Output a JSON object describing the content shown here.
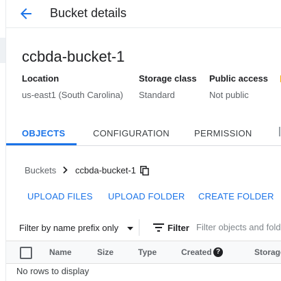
{
  "header": {
    "title": "Bucket details"
  },
  "bucket": {
    "name": "ccbda-bucket-1"
  },
  "info": [
    {
      "label": "Location",
      "value": "us-east1 (South Carolina)"
    },
    {
      "label": "Storage class",
      "value": "Standard"
    },
    {
      "label": "Public access",
      "value": "Not public"
    }
  ],
  "tabs": [
    {
      "label": "OBJECTS",
      "active": true
    },
    {
      "label": "CONFIGURATION",
      "active": false
    },
    {
      "label": "PERMISSION",
      "active": false
    }
  ],
  "breadcrumb": {
    "root": "Buckets",
    "current": "ccbda-bucket-1"
  },
  "actions": {
    "upload_files": "UPLOAD FILES",
    "upload_folder": "UPLOAD FOLDER",
    "create_folder": "CREATE FOLDER"
  },
  "filter": {
    "prefix_label": "Filter by name prefix only",
    "label": "Filter",
    "placeholder": "Filter objects and folders"
  },
  "table": {
    "columns": [
      "Name",
      "Size",
      "Type",
      "Created",
      "Storage"
    ],
    "empty_text": "No rows to display"
  },
  "colors": {
    "accent": "#1a73e8",
    "text": "#202124",
    "muted": "#5f6368"
  },
  "icons": [
    "arrow-back-icon",
    "chevron-right-icon",
    "copy-icon",
    "arrow-drop-down-icon",
    "filter-list-icon",
    "help-icon"
  ]
}
